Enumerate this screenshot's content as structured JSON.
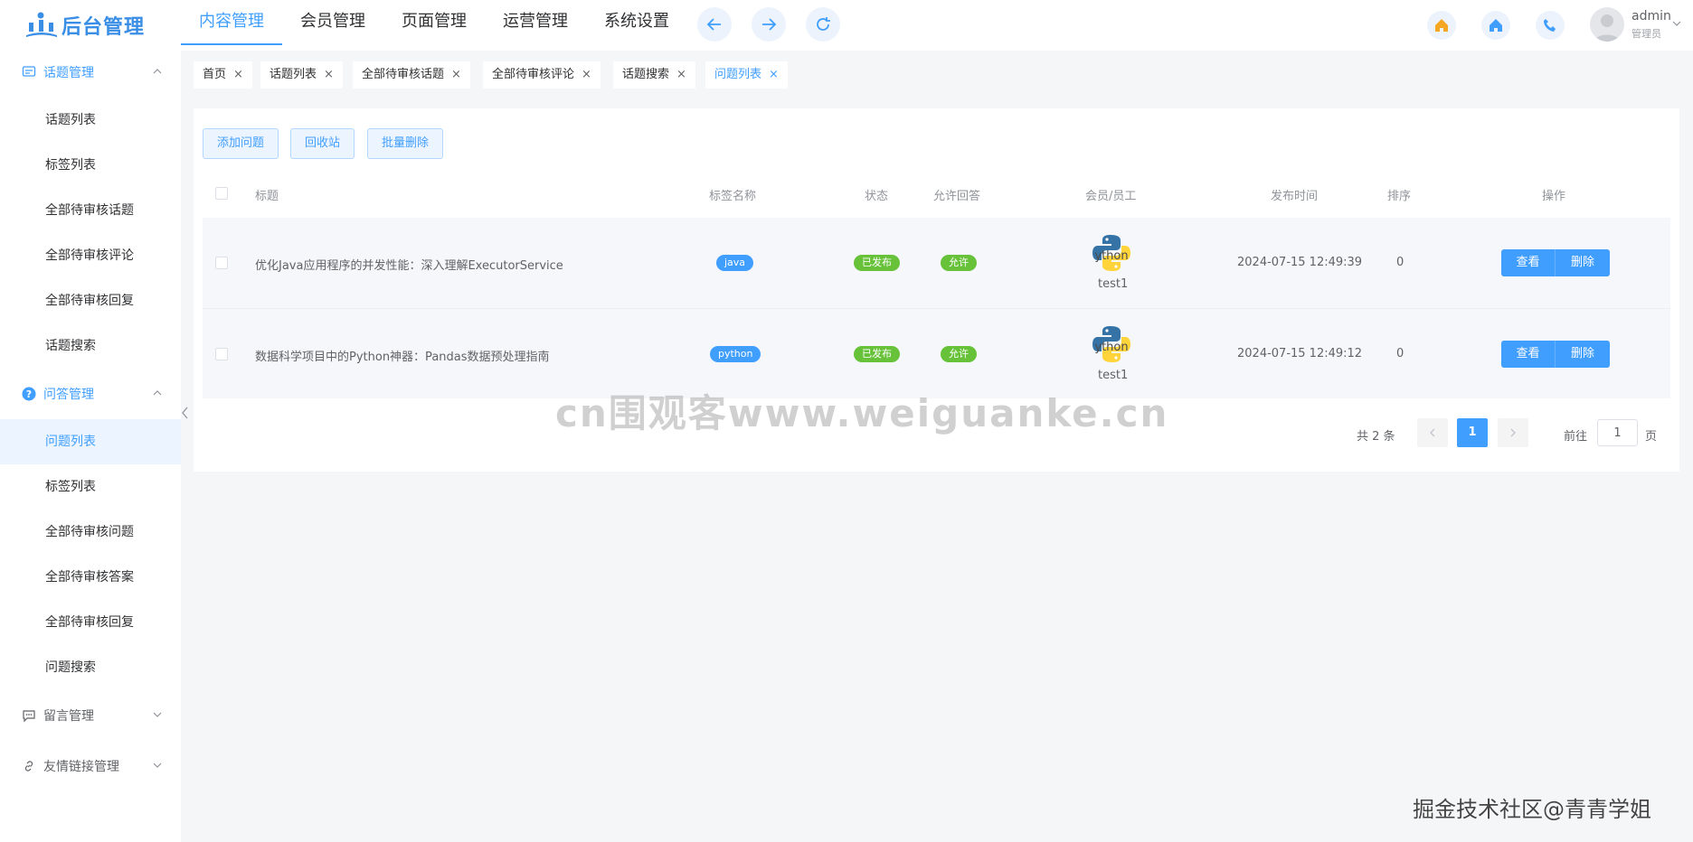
{
  "header": {
    "logo_text": "后台管理",
    "nav": [
      "内容管理",
      "会员管理",
      "页面管理",
      "运营管理",
      "系统设置"
    ],
    "user_name": "admin",
    "user_role": "管理员"
  },
  "sidebar": {
    "groups": [
      {
        "label": "话题管理",
        "icon": "chat-icon",
        "items": [
          "话题列表",
          "标签列表",
          "全部待审核话题",
          "全部待审核评论",
          "全部待审核回复",
          "话题搜索"
        ]
      },
      {
        "label": "问答管理",
        "icon": "question-icon",
        "items": [
          "问题列表",
          "标签列表",
          "全部待审核问题",
          "全部待审核答案",
          "全部待审核回复",
          "问题搜索"
        ]
      },
      {
        "label": "留言管理",
        "icon": "message-icon",
        "items": []
      },
      {
        "label": "友情链接管理",
        "icon": "link-icon",
        "items": []
      }
    ]
  },
  "tabs": [
    "首页",
    "话题列表",
    "全部待审核话题",
    "全部待审核评论",
    "话题搜索",
    "问题列表"
  ],
  "toolbar": {
    "add": "添加问题",
    "recycle": "回收站",
    "batch_delete": "批量删除"
  },
  "table": {
    "headers": [
      "标题",
      "标签名称",
      "状态",
      "允许回答",
      "会员/员工",
      "发布时间",
      "排序",
      "操作"
    ],
    "rows": [
      {
        "title": "优化Java应用程序的并发性能：深入理解ExecutorService",
        "tag": "java",
        "status": "已发布",
        "allow": "允许",
        "member": "test1",
        "time": "2024-07-15 12:49:39",
        "order": "0"
      },
      {
        "title": "数据科学项目中的Python神器：Pandas数据预处理指南",
        "tag": "python",
        "status": "已发布",
        "allow": "允许",
        "member": "test1",
        "time": "2024-07-15 12:49:12",
        "order": "0"
      }
    ],
    "actions": {
      "view": "查看",
      "delete": "删除"
    }
  },
  "pagination": {
    "total": "共 2 条",
    "current": "1",
    "goto": "前往",
    "goto_value": "1",
    "page_unit": "页"
  },
  "watermarks": {
    "center": "cn围观客www.weiguanke.cn",
    "corner": "掘金技术社区@青青学姐"
  },
  "colors": {
    "primary": "#409eff",
    "success": "#67c23a",
    "orange": "#f5a623"
  }
}
